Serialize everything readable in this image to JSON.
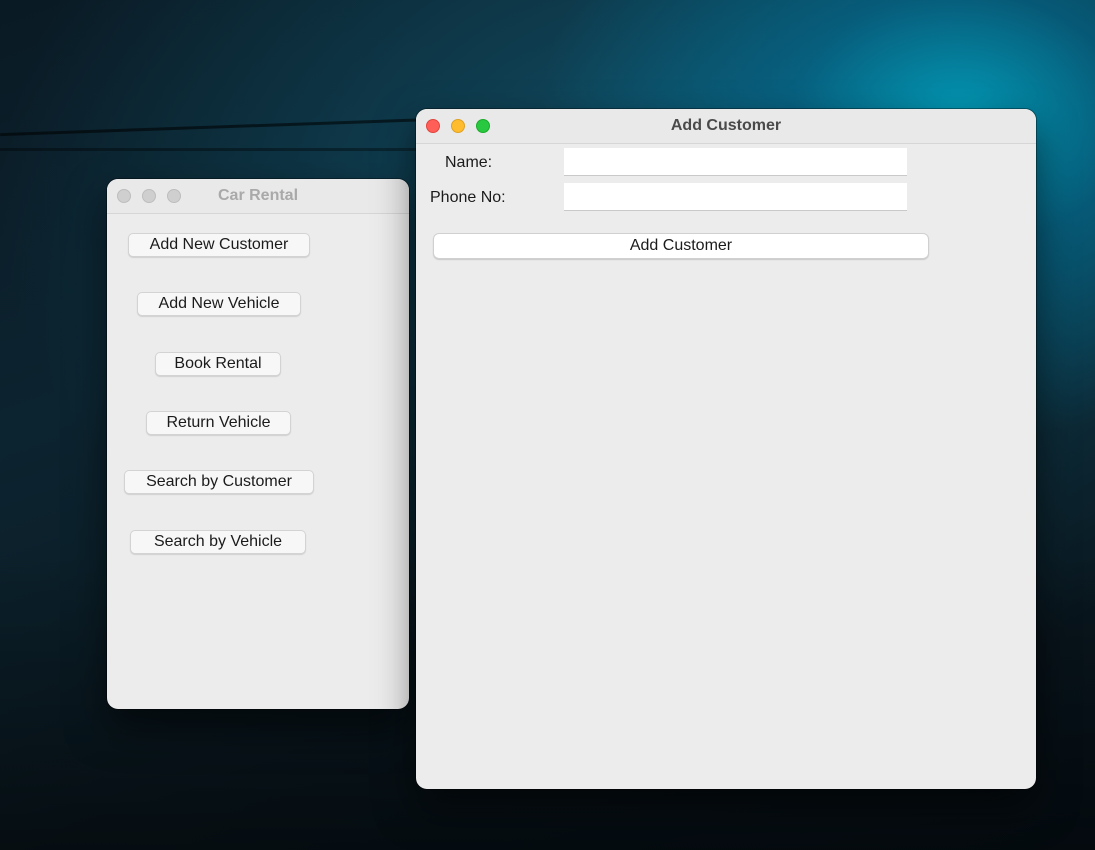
{
  "desktop": {
    "wallpaper": "dark-teal-garage"
  },
  "car_rental_window": {
    "title": "Car Rental",
    "active": false,
    "buttons": [
      {
        "label": "Add New Customer"
      },
      {
        "label": "Add New Vehicle"
      },
      {
        "label": "Book Rental"
      },
      {
        "label": "Return Vehicle"
      },
      {
        "label": "Search by Customer"
      },
      {
        "label": "Search by Vehicle"
      }
    ]
  },
  "add_customer_window": {
    "title": "Add Customer",
    "active": true,
    "fields": {
      "name_label": "Name:",
      "name_value": "",
      "phone_label": "Phone No:",
      "phone_value": ""
    },
    "submit_label": "Add Customer"
  },
  "colors": {
    "close": "#ff5f57",
    "minimize": "#febc2e",
    "zoom": "#28c840",
    "window_bg": "#ececec"
  }
}
